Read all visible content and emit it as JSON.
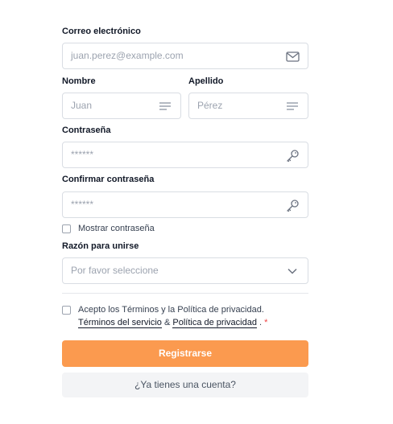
{
  "form": {
    "email": {
      "label": "Correo electrónico",
      "placeholder": "juan.perez@example.com",
      "icon": "mail-icon"
    },
    "first_name": {
      "label": "Nombre",
      "placeholder": "Juan",
      "icon": "lines-icon"
    },
    "last_name": {
      "label": "Apellido",
      "placeholder": "Pérez",
      "icon": "lines-icon"
    },
    "password": {
      "label": "Contraseña",
      "placeholder": "******",
      "icon": "key-icon"
    },
    "confirm_password": {
      "label": "Confirmar contraseña",
      "placeholder": "******",
      "icon": "key-icon"
    },
    "show_password": {
      "label": "Mostrar contraseña",
      "checked": false
    },
    "reason": {
      "label": "Razón para unirse",
      "selected": "Por favor seleccione",
      "icon": "chevron-down-icon"
    },
    "terms": {
      "text_before": "Acepto los Términos y la Política de privacidad.",
      "terms_link": "Términos del servicio",
      "and": "&",
      "privacy_link": "Política de privacidad",
      "period": ".",
      "required_mark": "*",
      "checked": false
    },
    "submit_label": "Registrarse",
    "login_label": "¿Ya tienes una cuenta?"
  },
  "colors": {
    "primary": "#fb9a4f",
    "secondary_bg": "#f3f4f6",
    "border": "#d9dde3",
    "required": "#ef4444"
  }
}
